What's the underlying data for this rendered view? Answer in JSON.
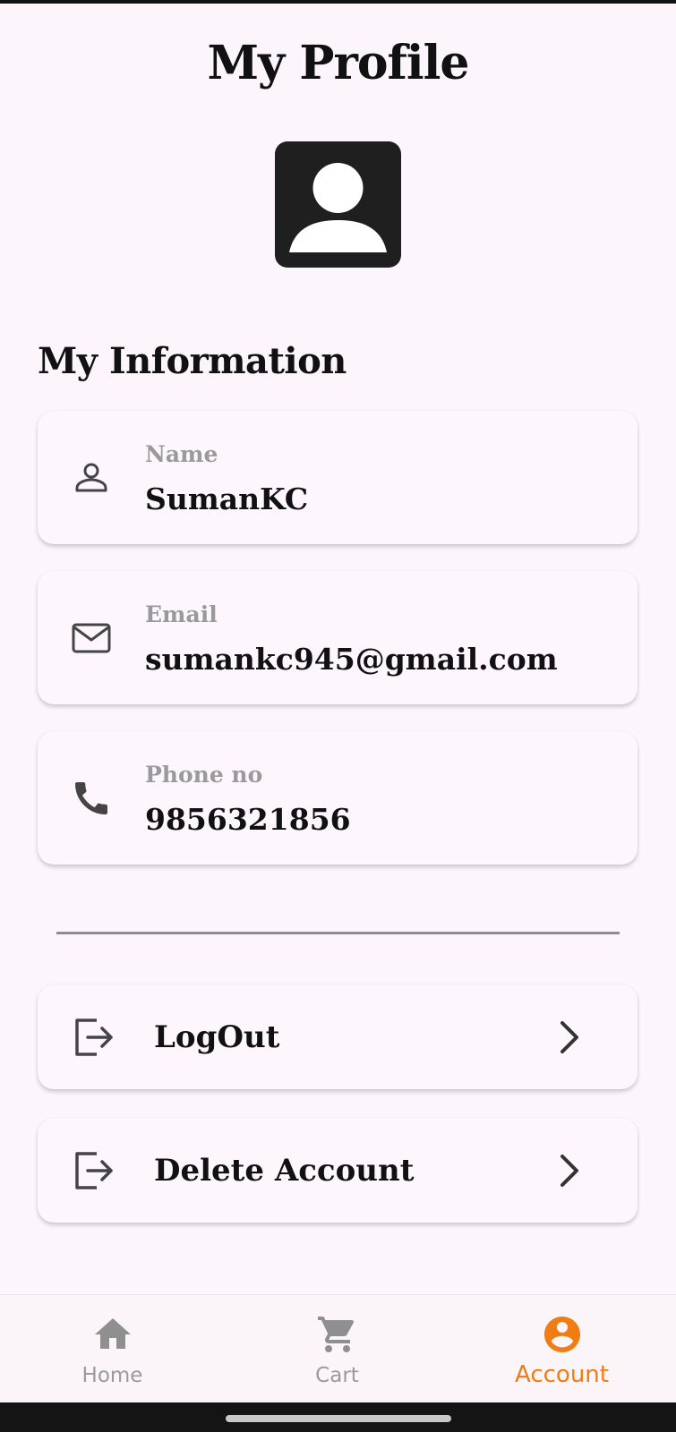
{
  "header": {
    "title": "My Profile"
  },
  "profile": {
    "avatar_icon": "account-box-icon"
  },
  "info_section": {
    "title": "My Information",
    "fields": [
      {
        "label": "Name",
        "value": "SumanKC",
        "icon": "person-icon"
      },
      {
        "label": "Email",
        "value": "sumankc945@gmail.com",
        "icon": "mail-icon"
      },
      {
        "label": "Phone no",
        "value": "9856321856",
        "icon": "phone-icon"
      }
    ]
  },
  "actions": [
    {
      "label": "LogOut",
      "icon": "logout-icon"
    },
    {
      "label": "Delete Account",
      "icon": "logout-icon"
    }
  ],
  "bottom_nav": {
    "items": [
      {
        "label": "Home",
        "icon": "home-icon",
        "active": false
      },
      {
        "label": "Cart",
        "icon": "cart-icon",
        "active": false
      },
      {
        "label": "Account",
        "icon": "account-circle-icon",
        "active": true
      }
    ],
    "active_color": "#f07c14",
    "inactive_color": "#9a9a9a"
  }
}
